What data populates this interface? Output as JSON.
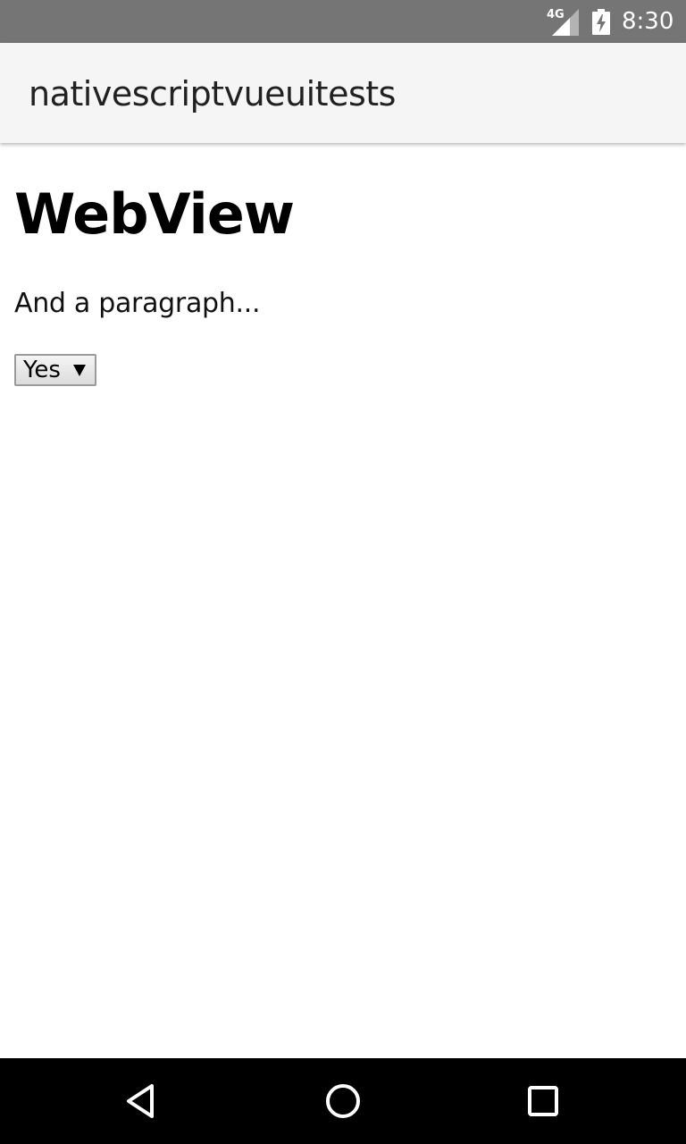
{
  "status_bar": {
    "network_label": "4G",
    "time": "8:30",
    "icons": [
      "signal-icon",
      "battery-charging-icon"
    ]
  },
  "action_bar": {
    "title": "nativescriptvueuitests"
  },
  "web_view": {
    "heading": "WebView",
    "paragraph": "And a paragraph...",
    "select": {
      "selected_value": "Yes"
    }
  },
  "navigation_bar": {
    "buttons": [
      "back-icon",
      "home-icon",
      "recents-icon"
    ]
  },
  "colors": {
    "status_bar": "#757575",
    "action_bar": "#f5f5f5",
    "navigation_bar": "#000000",
    "content_background": "#ffffff"
  }
}
